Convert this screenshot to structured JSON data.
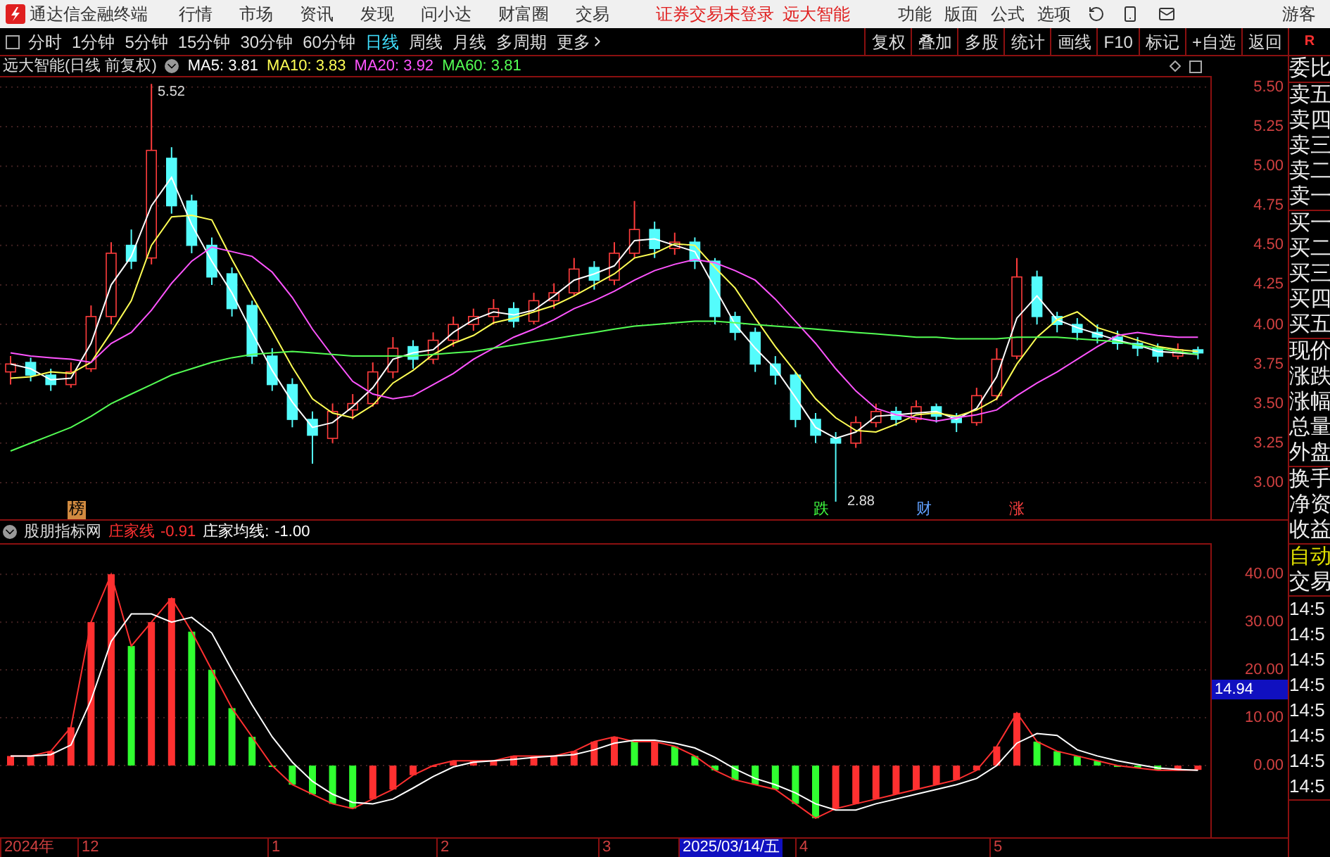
{
  "title_bar": {
    "app_name": "通达信金融终端",
    "menus": [
      "行情",
      "市场",
      "资讯",
      "发现",
      "问小达",
      "财富圈",
      "交易"
    ],
    "status": [
      "证券交易未登录",
      "远大智能"
    ],
    "right_menus": [
      "功能",
      "版面",
      "公式",
      "选项"
    ],
    "user": "游客"
  },
  "toolbar": {
    "periods": [
      {
        "label": "分时",
        "selected": false
      },
      {
        "label": "1分钟",
        "selected": false
      },
      {
        "label": "5分钟",
        "selected": false
      },
      {
        "label": "15分钟",
        "selected": false
      },
      {
        "label": "30分钟",
        "selected": false
      },
      {
        "label": "60分钟",
        "selected": false
      },
      {
        "label": "日线",
        "selected": true
      },
      {
        "label": "周线",
        "selected": false
      },
      {
        "label": "月线",
        "selected": false
      },
      {
        "label": "多周期",
        "selected": false
      }
    ],
    "more": "更多",
    "buttons": [
      "复权",
      "叠加",
      "多股",
      "统计",
      "画线",
      "F10",
      "标记",
      "+自选",
      "返回"
    ],
    "corner": "R"
  },
  "price_chart": {
    "title": "远大智能(日线 前复权)",
    "ma": [
      {
        "label": "MA5: 3.81",
        "color": "#ffffff"
      },
      {
        "label": "MA10: 3.83",
        "color": "#ffff54"
      },
      {
        "label": "MA20: 3.92",
        "color": "#ff54ff"
      },
      {
        "label": "MA60: 3.81",
        "color": "#54ff54"
      }
    ],
    "high_label": "5.52",
    "low_label": "2.88",
    "markers": [
      {
        "text": "榜",
        "kind": "badge",
        "color": "#d08a40"
      },
      {
        "text": "跌",
        "kind": "text",
        "color": "#40ff40"
      },
      {
        "text": "财",
        "kind": "text",
        "color": "#60a0ff"
      },
      {
        "text": "涨",
        "kind": "text",
        "color": "#ff4040"
      }
    ],
    "chart_data": {
      "type": "candlestick",
      "ylim": [
        2.76,
        5.57
      ],
      "grid": true,
      "yticks": [
        {
          "value": 5.5,
          "label": "5.50"
        },
        {
          "value": 5.25,
          "label": "5.25"
        },
        {
          "value": 5.0,
          "label": "5.00"
        },
        {
          "value": 4.75,
          "label": "4.75"
        },
        {
          "value": 4.5,
          "label": "4.50"
        },
        {
          "value": 4.25,
          "label": "4.25"
        },
        {
          "value": 4.0,
          "label": "4.00"
        },
        {
          "value": 3.75,
          "label": "3.75"
        },
        {
          "value": 3.5,
          "label": "3.50"
        },
        {
          "value": 3.25,
          "label": "3.25"
        },
        {
          "value": 3.0,
          "label": "3.00"
        }
      ],
      "series": [
        {
          "type": "line",
          "color": "#ffffff",
          "values": [
            3.75,
            3.72,
            3.65,
            3.66,
            3.88,
            4.25,
            4.43,
            4.75,
            4.93,
            4.63,
            4.4,
            4.2,
            3.95,
            3.71,
            3.51,
            3.35,
            3.38,
            3.48,
            3.6,
            3.78,
            3.82,
            3.84,
            3.95,
            4.03,
            4.08,
            4.06,
            4.09,
            4.18,
            4.28,
            4.32,
            4.37,
            4.53,
            4.54,
            4.5,
            4.46,
            4.23,
            4.0,
            3.85,
            3.72,
            3.54,
            3.35,
            3.28,
            3.32,
            3.42,
            3.43,
            3.44,
            3.45,
            3.4,
            3.47,
            3.67,
            4.04,
            4.18,
            4.03,
            3.98,
            3.94,
            3.9,
            3.87,
            3.83,
            3.82,
            3.81
          ]
        },
        {
          "type": "line",
          "color": "#ffff54",
          "values": [
            3.66,
            3.67,
            3.7,
            3.69,
            3.76,
            3.95,
            4.15,
            4.5,
            4.68,
            4.69,
            4.66,
            4.41,
            4.18,
            3.96,
            3.73,
            3.53,
            3.44,
            3.41,
            3.49,
            3.63,
            3.71,
            3.81,
            3.88,
            3.93,
            4.01,
            4.04,
            4.08,
            4.12,
            4.18,
            4.25,
            4.32,
            4.42,
            4.45,
            4.51,
            4.5,
            4.36,
            4.23,
            4.04,
            3.86,
            3.7,
            3.53,
            3.41,
            3.33,
            3.32,
            3.37,
            3.43,
            3.44,
            3.42,
            3.46,
            3.53,
            3.75,
            3.92,
            4.03,
            4.08,
            3.98,
            3.94,
            3.9,
            3.86,
            3.84,
            3.83
          ]
        },
        {
          "type": "line",
          "color": "#ff54ff",
          "values": [
            3.82,
            3.8,
            3.79,
            3.78,
            3.76,
            3.88,
            3.95,
            4.09,
            4.26,
            4.4,
            4.49,
            4.46,
            4.43,
            4.33,
            4.17,
            3.97,
            3.8,
            3.64,
            3.56,
            3.53,
            3.55,
            3.62,
            3.69,
            3.78,
            3.85,
            3.92,
            3.97,
            4.03,
            4.1,
            4.15,
            4.21,
            4.28,
            4.34,
            4.38,
            4.41,
            4.39,
            4.34,
            4.28,
            4.16,
            4.02,
            3.88,
            3.72,
            3.58,
            3.47,
            3.43,
            3.41,
            3.39,
            3.41,
            3.43,
            3.46,
            3.55,
            3.63,
            3.7,
            3.78,
            3.86,
            3.93,
            3.95,
            3.93,
            3.92,
            3.92
          ]
        },
        {
          "type": "line",
          "color": "#54ff54",
          "values": [
            3.2,
            3.25,
            3.3,
            3.35,
            3.42,
            3.5,
            3.56,
            3.62,
            3.68,
            3.72,
            3.76,
            3.79,
            3.81,
            3.82,
            3.83,
            3.82,
            3.81,
            3.8,
            3.8,
            3.8,
            3.8,
            3.81,
            3.82,
            3.83,
            3.85,
            3.87,
            3.89,
            3.91,
            3.93,
            3.95,
            3.97,
            3.99,
            4.0,
            4.01,
            4.02,
            4.02,
            4.01,
            4.0,
            3.99,
            3.98,
            3.97,
            3.96,
            3.95,
            3.94,
            3.93,
            3.92,
            3.92,
            3.91,
            3.91,
            3.91,
            3.92,
            3.92,
            3.92,
            3.91,
            3.9,
            3.89,
            3.87,
            3.85,
            3.83,
            3.81
          ]
        }
      ],
      "ohlc": [
        [
          3.7,
          3.8,
          3.62,
          3.75
        ],
        [
          3.76,
          3.79,
          3.64,
          3.68
        ],
        [
          3.68,
          3.72,
          3.58,
          3.62
        ],
        [
          3.62,
          3.76,
          3.6,
          3.7
        ],
        [
          3.72,
          4.12,
          3.7,
          4.05
        ],
        [
          4.05,
          4.52,
          4.0,
          4.45
        ],
        [
          4.5,
          4.6,
          4.35,
          4.4
        ],
        [
          4.42,
          5.52,
          4.38,
          5.1
        ],
        [
          5.05,
          5.12,
          4.7,
          4.75
        ],
        [
          4.78,
          4.82,
          4.45,
          4.5
        ],
        [
          4.5,
          4.55,
          4.25,
          4.3
        ],
        [
          4.32,
          4.36,
          4.05,
          4.1
        ],
        [
          4.12,
          4.15,
          3.75,
          3.8
        ],
        [
          3.8,
          3.85,
          3.58,
          3.62
        ],
        [
          3.62,
          3.66,
          3.35,
          3.4
        ],
        [
          3.4,
          3.45,
          3.12,
          3.3
        ],
        [
          3.28,
          3.5,
          3.25,
          3.45
        ],
        [
          3.46,
          3.56,
          3.4,
          3.5
        ],
        [
          3.5,
          3.76,
          3.48,
          3.7
        ],
        [
          3.7,
          3.92,
          3.66,
          3.85
        ],
        [
          3.86,
          3.9,
          3.72,
          3.78
        ],
        [
          3.78,
          3.95,
          3.75,
          3.9
        ],
        [
          3.9,
          4.05,
          3.86,
          4.0
        ],
        [
          4.0,
          4.1,
          3.96,
          4.05
        ],
        [
          4.05,
          4.16,
          4.0,
          4.1
        ],
        [
          4.1,
          4.14,
          3.98,
          4.02
        ],
        [
          4.02,
          4.2,
          4.0,
          4.15
        ],
        [
          4.15,
          4.26,
          4.1,
          4.2
        ],
        [
          4.2,
          4.42,
          4.18,
          4.35
        ],
        [
          4.36,
          4.4,
          4.22,
          4.28
        ],
        [
          4.28,
          4.52,
          4.25,
          4.45
        ],
        [
          4.45,
          4.78,
          4.42,
          4.6
        ],
        [
          4.6,
          4.65,
          4.42,
          4.48
        ],
        [
          4.48,
          4.58,
          4.44,
          4.52
        ],
        [
          4.52,
          4.55,
          4.35,
          4.4
        ],
        [
          4.4,
          4.42,
          4.0,
          4.05
        ],
        [
          4.05,
          4.08,
          3.9,
          3.95
        ],
        [
          3.95,
          3.98,
          3.7,
          3.75
        ],
        [
          3.75,
          3.8,
          3.62,
          3.68
        ],
        [
          3.68,
          3.7,
          3.35,
          3.4
        ],
        [
          3.4,
          3.44,
          3.25,
          3.3
        ],
        [
          3.28,
          3.32,
          2.88,
          3.25
        ],
        [
          3.25,
          3.42,
          3.22,
          3.38
        ],
        [
          3.38,
          3.5,
          3.35,
          3.45
        ],
        [
          3.45,
          3.48,
          3.36,
          3.4
        ],
        [
          3.4,
          3.52,
          3.38,
          3.48
        ],
        [
          3.48,
          3.5,
          3.38,
          3.42
        ],
        [
          3.42,
          3.44,
          3.32,
          3.38
        ],
        [
          3.38,
          3.6,
          3.36,
          3.55
        ],
        [
          3.55,
          3.85,
          3.52,
          3.78
        ],
        [
          3.8,
          4.42,
          3.78,
          4.3
        ],
        [
          4.3,
          4.34,
          4.0,
          4.05
        ],
        [
          4.05,
          4.08,
          3.95,
          4.0
        ],
        [
          4.0,
          4.04,
          3.9,
          3.95
        ],
        [
          3.95,
          4.0,
          3.88,
          3.92
        ],
        [
          3.92,
          3.96,
          3.84,
          3.88
        ],
        [
          3.88,
          3.92,
          3.8,
          3.85
        ],
        [
          3.85,
          3.88,
          3.76,
          3.8
        ],
        [
          3.8,
          3.88,
          3.78,
          3.84
        ],
        [
          3.84,
          3.86,
          3.78,
          3.82
        ]
      ]
    }
  },
  "indicator": {
    "name": "股朋指标网",
    "lines": [
      {
        "label": "庄家线",
        "value": "-0.91",
        "color": "#ff3030"
      },
      {
        "label": "庄家均线:",
        "value": "-1.00",
        "color": "#ffffff"
      }
    ],
    "cursor_value": "14.94",
    "chart_data": {
      "type": "bar",
      "ylim": [
        -15,
        46.5
      ],
      "grid": true,
      "colors": [
        "#ff3030",
        "#ff3030",
        "#ff3030",
        "#ff3030",
        "#ff3030",
        "#ff3030",
        "#30ff30",
        "#ff3030",
        "#ff3030",
        "#30ff30",
        "#30ff30",
        "#30ff30",
        "#30ff30",
        "#30ff30",
        "#30ff30",
        "#30ff30",
        "#30ff30",
        "#30ff30",
        "#ff3030",
        "#ff3030",
        "#ff3030",
        "#ff3030",
        "#ff3030",
        "#ff3030",
        "#ff3030",
        "#ff3030",
        "#ff3030",
        "#ff3030",
        "#ff3030",
        "#ff3030",
        "#ff3030",
        "#30ff30",
        "#ff3030",
        "#30ff30",
        "#30ff30",
        "#30ff30",
        "#30ff30",
        "#30ff30",
        "#30ff30",
        "#30ff30",
        "#30ff30",
        "#ff3030",
        "#ff3030",
        "#ff3030",
        "#ff3030",
        "#ff3030",
        "#ff3030",
        "#ff3030",
        "#ff3030",
        "#ff3030",
        "#ff3030",
        "#30ff30",
        "#30ff30",
        "#30ff30",
        "#30ff30",
        "#30ff30",
        "#30ff30",
        "#30ff30",
        "#ff3030",
        "#ff3030"
      ],
      "series": [
        {
          "type": "line",
          "color": "#ff3030",
          "values": [
            2,
            2,
            3,
            8,
            30,
            40,
            25,
            30,
            35,
            28,
            20,
            12,
            6,
            0,
            -4,
            -6,
            -8,
            -9,
            -7,
            -5,
            -2,
            0,
            1,
            1,
            1,
            2,
            2,
            2,
            3,
            5,
            6,
            5,
            5,
            4,
            2,
            -1,
            -3,
            -4,
            -5,
            -8,
            -11,
            -9,
            -8,
            -7,
            -6,
            -5,
            -4,
            -3,
            -1,
            4,
            11,
            5,
            3,
            2,
            1,
            0,
            -0.5,
            -1,
            -1,
            -0.9
          ]
        },
        {
          "type": "line",
          "color": "#ffffff",
          "values": [
            2,
            2,
            2.3,
            4.3,
            13.7,
            26,
            31.7,
            31.7,
            30,
            31,
            27.7,
            20,
            12.7,
            6,
            0.7,
            -3.3,
            -6,
            -7.7,
            -8,
            -7,
            -4.7,
            -2.3,
            -0.3,
            0.7,
            1,
            1.3,
            1.7,
            2,
            2.3,
            3.3,
            4.7,
            5.3,
            5.3,
            4.7,
            3.7,
            1.7,
            -0.7,
            -2.7,
            -4,
            -5.7,
            -8,
            -9.3,
            -9.3,
            -8,
            -7,
            -6,
            -5,
            -4,
            -2.7,
            0,
            4.7,
            6.7,
            6.3,
            3.3,
            2,
            1,
            0.2,
            -0.5,
            -0.8,
            -1
          ]
        }
      ],
      "yticks": [
        {
          "value": 40,
          "label": "40.00"
        },
        {
          "value": 30,
          "label": "30.00"
        },
        {
          "value": 20,
          "label": "20.00"
        },
        {
          "value": 10,
          "label": "10.00"
        },
        {
          "value": 0,
          "label": "0.00"
        }
      ],
      "values": [
        2,
        2,
        3,
        8,
        30,
        40,
        25,
        30,
        35,
        28,
        20,
        12,
        6,
        0,
        -4,
        -6,
        -8,
        -9,
        -7,
        -5,
        -2,
        0,
        1,
        1,
        1,
        2,
        2,
        2,
        3,
        5,
        6,
        5,
        5,
        4,
        2,
        -1,
        -3,
        -4,
        -5,
        -8,
        -11,
        -9,
        -8,
        -7,
        -6,
        -5,
        -4,
        -3,
        -1,
        4,
        11,
        5,
        3,
        2,
        1,
        0,
        -0.5,
        -1,
        -1,
        -0.9
      ]
    }
  },
  "date_axis": [
    {
      "label": "2024年",
      "selected": false
    },
    {
      "label": "12",
      "selected": false
    },
    {
      "label": "1",
      "selected": false
    },
    {
      "label": "2",
      "selected": false
    },
    {
      "label": "3",
      "selected": false
    },
    {
      "label": "2025/03/14/五",
      "selected": true
    },
    {
      "label": "4",
      "selected": false
    },
    {
      "label": "5",
      "selected": false
    }
  ],
  "side_panel": {
    "groups": [
      [
        {
          "label": "委比",
          "kind": "label"
        }
      ],
      [
        {
          "label": "卖五",
          "kind": "label"
        },
        {
          "label": "卖四",
          "kind": "label"
        },
        {
          "label": "卖三",
          "kind": "label"
        },
        {
          "label": "卖二",
          "kind": "label"
        },
        {
          "label": "卖一",
          "kind": "label"
        }
      ],
      [
        {
          "label": "买一",
          "kind": "label"
        },
        {
          "label": "买二",
          "kind": "label"
        },
        {
          "label": "买三",
          "kind": "label"
        },
        {
          "label": "买四",
          "kind": "label"
        },
        {
          "label": "买五",
          "kind": "label"
        }
      ],
      [
        {
          "label": "现价",
          "kind": "label"
        },
        {
          "label": "涨跌",
          "kind": "label"
        },
        {
          "label": "涨幅",
          "kind": "label"
        },
        {
          "label": "总量",
          "kind": "label"
        },
        {
          "label": "外盘",
          "kind": "label"
        }
      ],
      [
        {
          "label": "换手",
          "kind": "label"
        },
        {
          "label": "净资",
          "kind": "label"
        },
        {
          "label": "收益",
          "kind": "label"
        }
      ],
      [
        {
          "label": "自动",
          "kind": "mode"
        },
        {
          "label": "交易",
          "kind": "label"
        }
      ],
      [
        {
          "label": "14:5",
          "kind": "time"
        },
        {
          "label": "14:5",
          "kind": "time"
        },
        {
          "label": "14:5",
          "kind": "time"
        },
        {
          "label": "14:5",
          "kind": "time"
        },
        {
          "label": "14:5",
          "kind": "time"
        },
        {
          "label": "14:5",
          "kind": "time"
        },
        {
          "label": "14:5",
          "kind": "time"
        },
        {
          "label": "14:5",
          "kind": "time"
        }
      ]
    ]
  }
}
